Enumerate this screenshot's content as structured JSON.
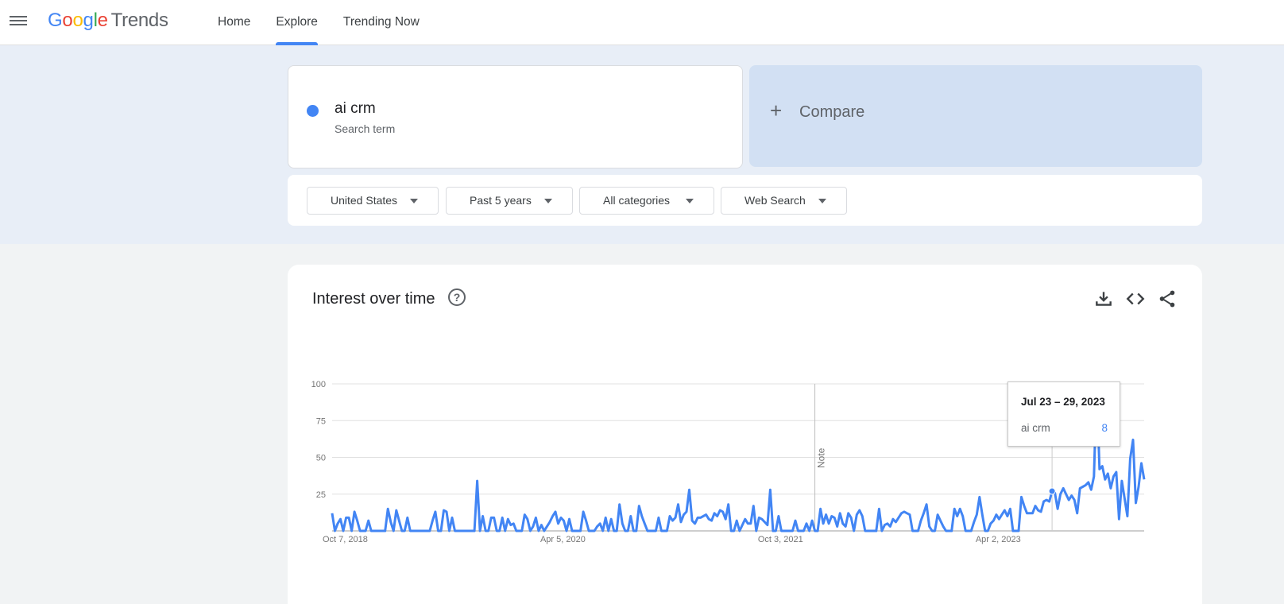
{
  "header": {
    "logo_google": [
      "G",
      "o",
      "o",
      "g",
      "l",
      "e"
    ],
    "logo_trends": "Trends",
    "nav": [
      {
        "label": "Home",
        "active": false
      },
      {
        "label": "Explore",
        "active": true
      },
      {
        "label": "Trending Now",
        "active": false
      }
    ]
  },
  "search": {
    "term": "ai crm",
    "term_sub": "Search term",
    "term_color": "#4285f4",
    "compare_label": "Compare"
  },
  "filters": {
    "region": "United States",
    "time": "Past 5 years",
    "category": "All categories",
    "property": "Web Search"
  },
  "chart_panel": {
    "title": "Interest over time",
    "tools": [
      "download-icon",
      "embed-code-icon",
      "share-icon"
    ]
  },
  "tooltip": {
    "date": "Jul 23 – 29, 2023",
    "term": "ai crm",
    "value": "8"
  },
  "chart_data": {
    "type": "line",
    "title": "",
    "xlabel": "",
    "ylabel": "",
    "ylim": [
      0,
      100
    ],
    "yticks": [
      25,
      50,
      75,
      100
    ],
    "x_tick_labels": [
      "Oct 7, 2018",
      "Apr 5, 2020",
      "Oct 3, 2021",
      "Apr 2, 2023"
    ],
    "annotation": "Note",
    "grid": true,
    "series": [
      {
        "name": "ai crm",
        "color": "#4285f4",
        "values": [
          12,
          0,
          5,
          8,
          0,
          9,
          9,
          0,
          13,
          7,
          0,
          0,
          0,
          7,
          0,
          0,
          0,
          0,
          0,
          0,
          15,
          6,
          0,
          14,
          7,
          0,
          0,
          9,
          0,
          0,
          0,
          0,
          0,
          0,
          0,
          0,
          7,
          13,
          0,
          0,
          14,
          13,
          0,
          9,
          0,
          0,
          0,
          0,
          0,
          0,
          0,
          0,
          34,
          0,
          10,
          0,
          0,
          9,
          9,
          0,
          0,
          9,
          0,
          8,
          4,
          5,
          0,
          0,
          0,
          11,
          8,
          0,
          3,
          9,
          0,
          4,
          0,
          3,
          6,
          10,
          13,
          5,
          9,
          7,
          0,
          8,
          0,
          0,
          0,
          0,
          13,
          7,
          0,
          0,
          0,
          3,
          5,
          0,
          9,
          0,
          8,
          0,
          0,
          18,
          5,
          0,
          0,
          10,
          0,
          0,
          17,
          10,
          5,
          0,
          0,
          0,
          0,
          9,
          0,
          0,
          0,
          10,
          7,
          9,
          18,
          6,
          11,
          13,
          28,
          7,
          5,
          9,
          9,
          10,
          11,
          8,
          7,
          12,
          10,
          14,
          13,
          8,
          18,
          0,
          0,
          7,
          0,
          4,
          8,
          5,
          5,
          17,
          0,
          9,
          8,
          6,
          4,
          28,
          0,
          0,
          10,
          0,
          0,
          0,
          0,
          0,
          7,
          0,
          0,
          0,
          5,
          0,
          7,
          0,
          0,
          15,
          5,
          11,
          5,
          10,
          9,
          3,
          12,
          5,
          3,
          12,
          9,
          0,
          11,
          14,
          10,
          0,
          0,
          0,
          0,
          0,
          15,
          0,
          4,
          5,
          3,
          8,
          6,
          9,
          12,
          13,
          12,
          11,
          0,
          0,
          0,
          7,
          12,
          18,
          3,
          0,
          0,
          11,
          7,
          3,
          0,
          0,
          0,
          15,
          10,
          15,
          10,
          0,
          0,
          0,
          6,
          11,
          23,
          11,
          0,
          0,
          5,
          7,
          11,
          8,
          11,
          14,
          10,
          15,
          0,
          0,
          0,
          23,
          17,
          12,
          12,
          12,
          17,
          14,
          13,
          20,
          21,
          20,
          27,
          26,
          15,
          25,
          29,
          25,
          21,
          24,
          21,
          12,
          29,
          30,
          31,
          33,
          28,
          37,
          100,
          42,
          44,
          35,
          39,
          29,
          37,
          40,
          8,
          34,
          22,
          10,
          49,
          62,
          19,
          30,
          46,
          35
        ]
      }
    ]
  }
}
